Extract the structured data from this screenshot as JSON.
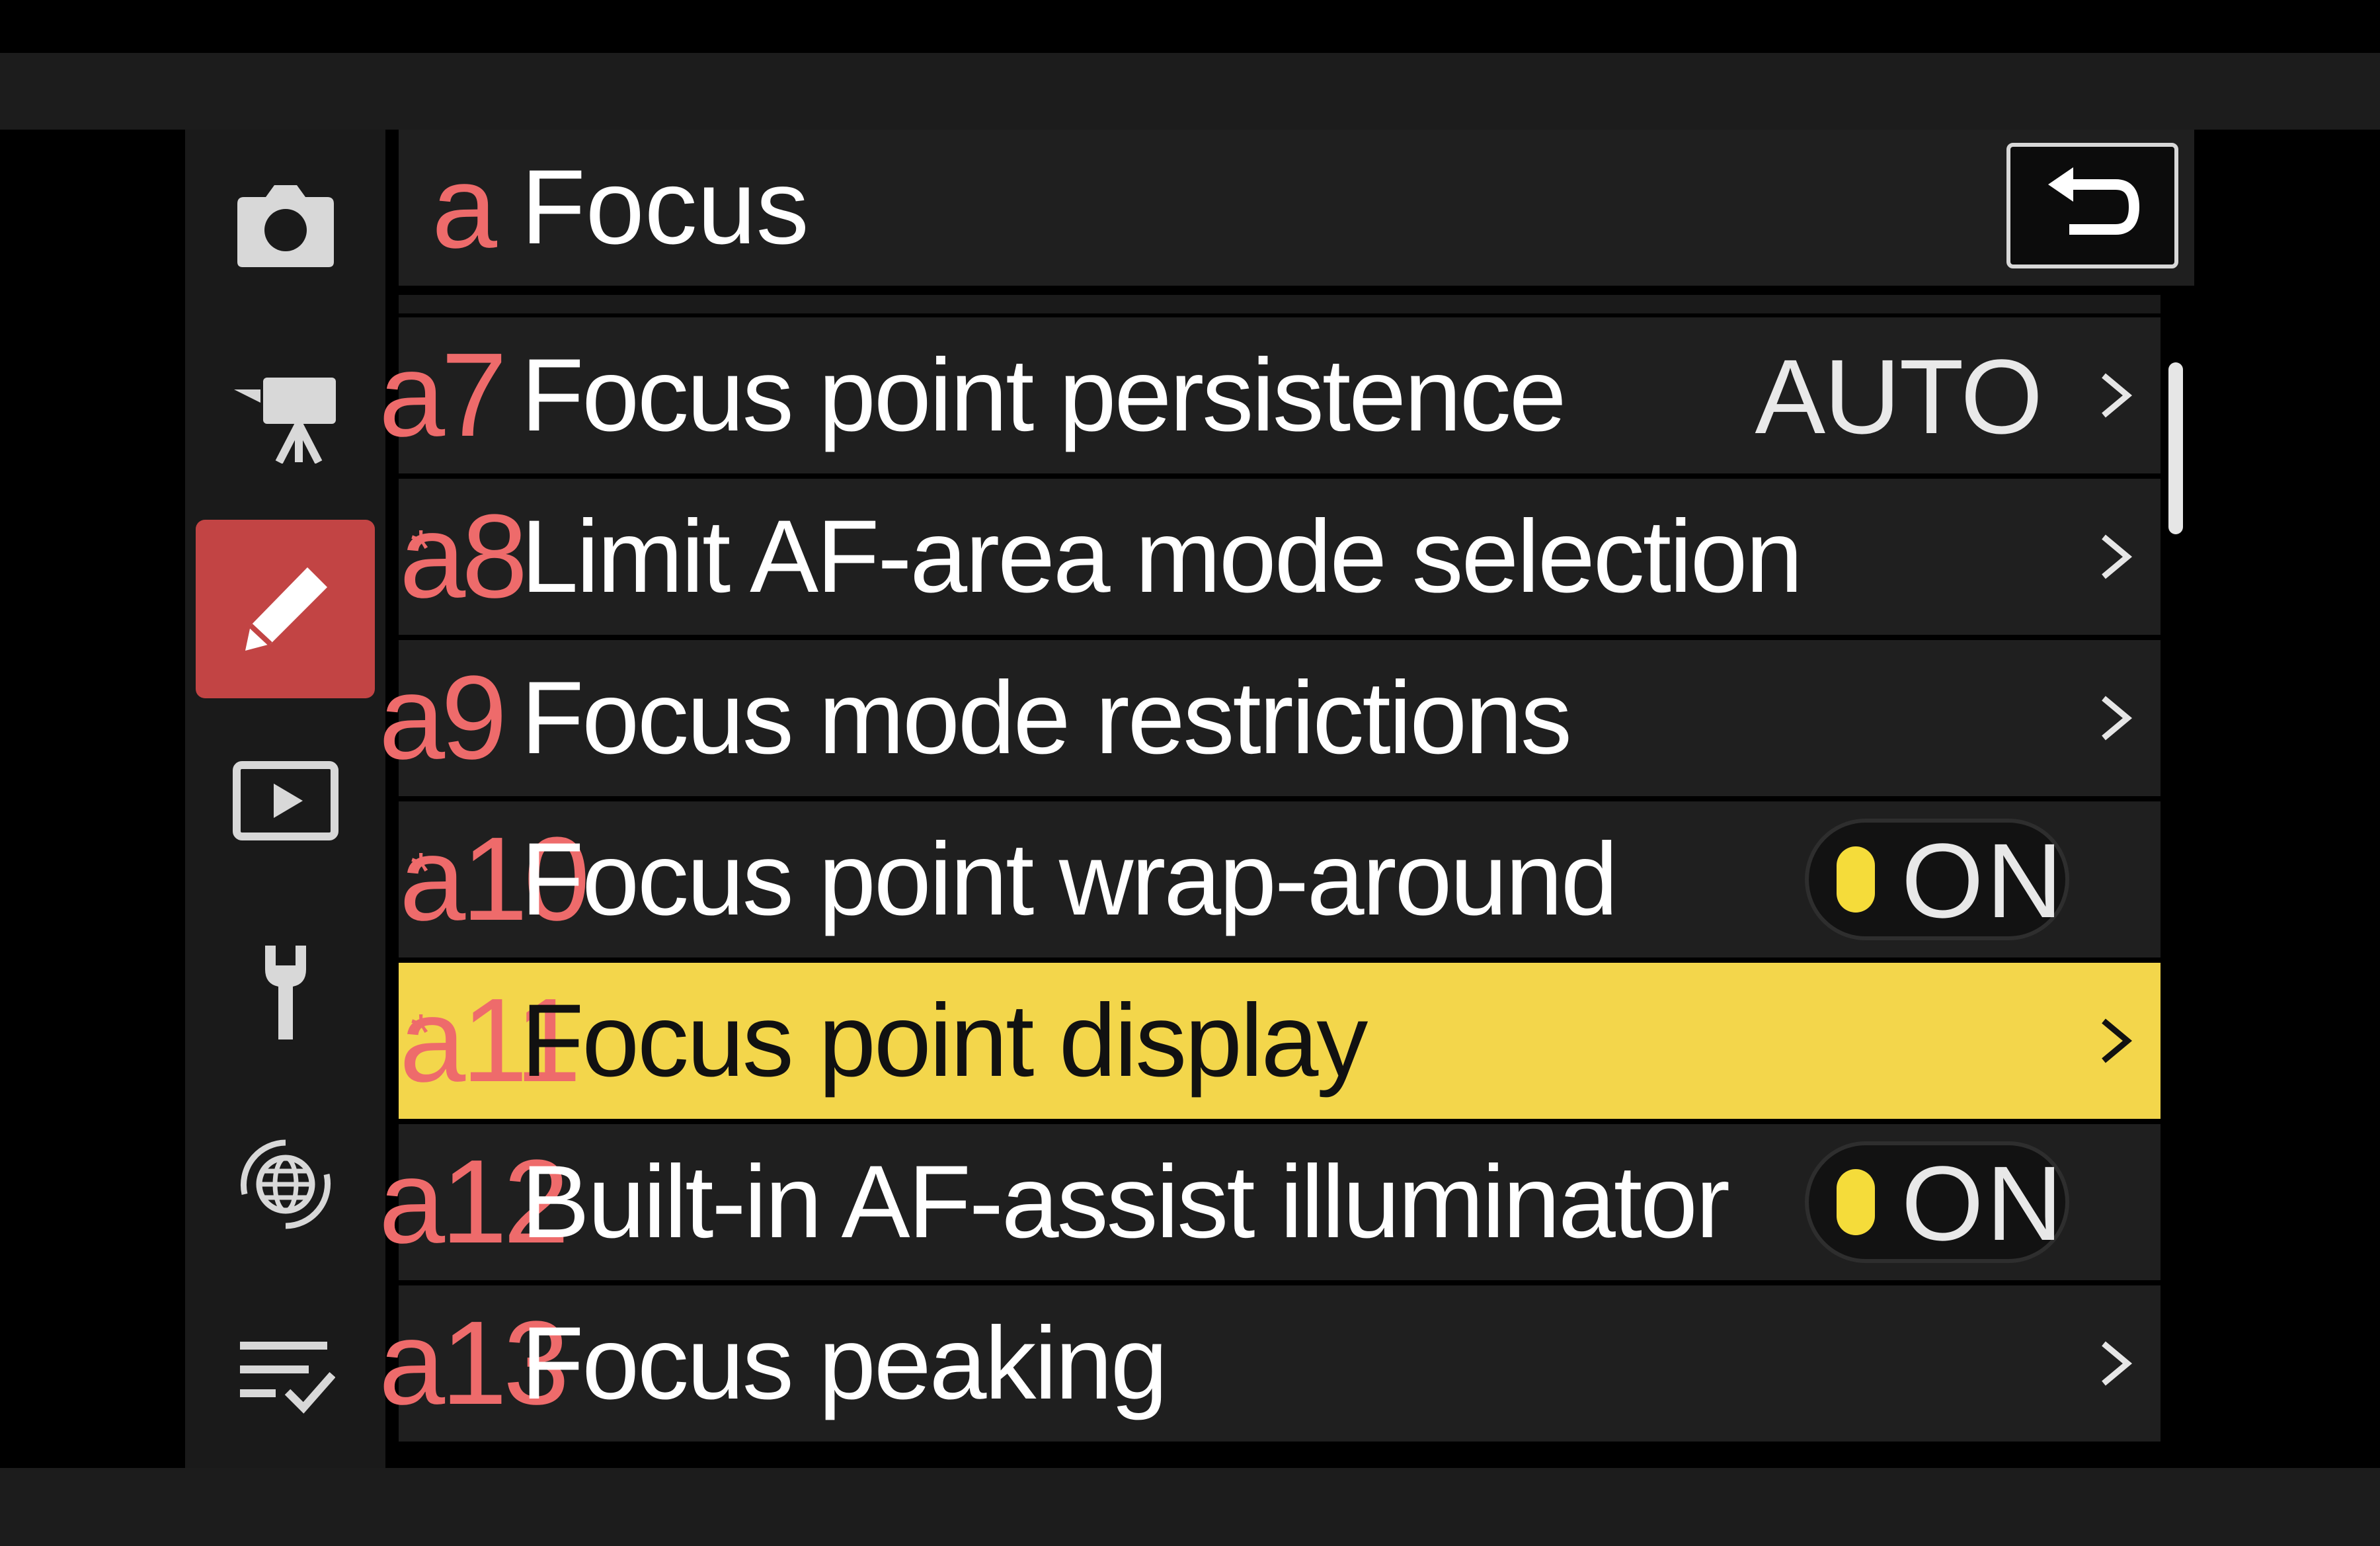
{
  "header": {
    "section_letter": "a",
    "title": "Focus"
  },
  "sidebar": {
    "items": [
      {
        "name": "camera-icon"
      },
      {
        "name": "movie-camera-icon"
      },
      {
        "name": "pencil-icon",
        "active": true
      },
      {
        "name": "playback-icon"
      },
      {
        "name": "wrench-icon"
      },
      {
        "name": "network-globe-icon"
      },
      {
        "name": "my-menu-icon"
      }
    ]
  },
  "menu": {
    "items": [
      {
        "code": "a7",
        "star": "",
        "label": "Focus point persistence",
        "value": "AUTO"
      },
      {
        "code": "a8",
        "star": "*",
        "label": "Limit AF-area mode selection"
      },
      {
        "code": "a9",
        "star": "",
        "label": "Focus mode restrictions"
      },
      {
        "code": "a10",
        "star": "*",
        "label": "Focus point wrap-around",
        "toggle": "ON"
      },
      {
        "code": "a11",
        "star": "*",
        "label": "Focus point display",
        "selected": true
      },
      {
        "code": "a12",
        "star": "",
        "label": "Built-in AF-assist illuminator",
        "toggle": "ON"
      },
      {
        "code": "a13",
        "star": "",
        "label": "Focus peaking"
      }
    ]
  },
  "colors": {
    "accent_red": "#ee6b6b",
    "highlight_yellow": "#f3d64b",
    "toggle_knob": "#f5dc3a",
    "active_tab": "#c24444"
  }
}
